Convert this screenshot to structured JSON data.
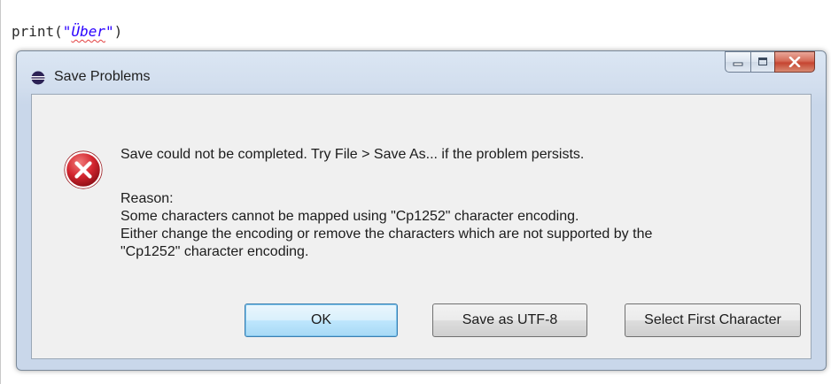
{
  "editor": {
    "code_prefix": "print(",
    "code_quote_open": "\"",
    "code_string": "Über",
    "code_quote_close": "\"",
    "code_suffix": ")"
  },
  "dialog": {
    "title": "Save Problems",
    "main_message": "Save could not be completed. Try File > Save As... if the problem persists.",
    "reason_label": "Reason:",
    "reason_lines": [
      "Some characters cannot be mapped using \"Cp1252\" character encoding.",
      "Either change the encoding or remove the characters which are not supported by the",
      "\"Cp1252\" character encoding."
    ],
    "buttons": {
      "ok": "OK",
      "save_utf8": "Save as UTF-8",
      "select_first": "Select First Character"
    }
  },
  "colors": {
    "string_literal": "#2a00ff",
    "error_icon": "#c8202a",
    "close_button": "#c64531"
  },
  "icons": {
    "app": "eclipse-icon",
    "error": "error-icon",
    "minimize": "minimize-icon",
    "maximize": "maximize-icon",
    "close": "close-icon"
  }
}
